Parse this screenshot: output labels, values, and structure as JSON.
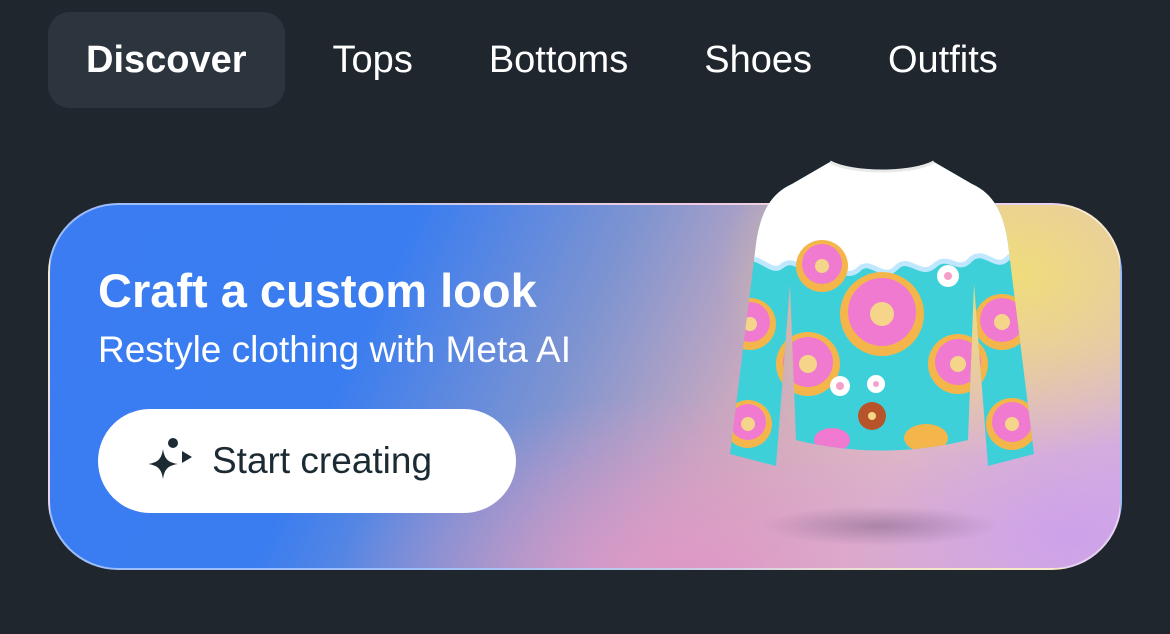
{
  "tabs": [
    {
      "label": "Discover",
      "active": true
    },
    {
      "label": "Tops",
      "active": false
    },
    {
      "label": "Bottoms",
      "active": false
    },
    {
      "label": "Shoes",
      "active": false
    },
    {
      "label": "Outfits",
      "active": false
    }
  ],
  "banner": {
    "title": "Craft a custom look",
    "subtitle": "Restyle clothing with Meta AI",
    "cta_label": "Start creating",
    "cta_icon": "sparkle-icon",
    "image": "donut-print-sweater"
  },
  "colors": {
    "background": "#1f262e",
    "active_tab_bg": "#2c353e",
    "banner_blue": "#3b7cf2",
    "banner_yellow": "#f0de78",
    "banner_pink": "#e096c8",
    "cta_text": "#1c2b33"
  }
}
